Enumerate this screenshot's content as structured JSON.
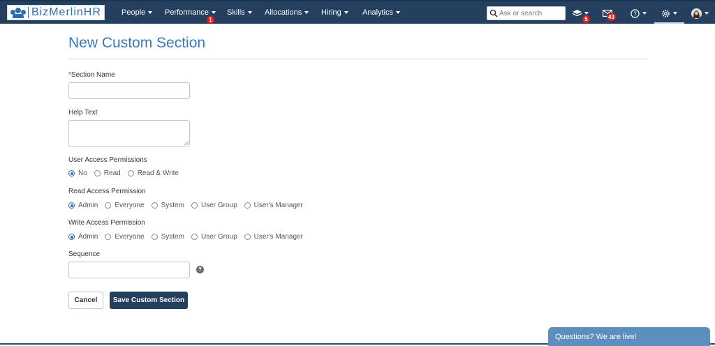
{
  "app": {
    "logo_text": "BizMerlinHR"
  },
  "nav": {
    "items": [
      {
        "label": "People"
      },
      {
        "label": "Performance",
        "badge": "1"
      },
      {
        "label": "Skills"
      },
      {
        "label": "Allocations"
      },
      {
        "label": "Hiring"
      },
      {
        "label": "Analytics"
      }
    ],
    "search_placeholder": "Ask or search",
    "icons": [
      {
        "name": "layers-icon",
        "badge": "5"
      },
      {
        "name": "mail-icon",
        "badge": "43"
      },
      {
        "name": "help-circle-icon"
      },
      {
        "name": "gear-icon"
      },
      {
        "name": "avatar"
      }
    ]
  },
  "page": {
    "title": "New Custom Section",
    "fields": {
      "section_name": {
        "label": "Section Name",
        "required_mark": "*",
        "value": ""
      },
      "help_text": {
        "label": "Help Text",
        "value": ""
      },
      "user_access": {
        "label": "User Access Permissions",
        "options": [
          "No",
          "Read",
          "Read & Write"
        ],
        "selected": "No"
      },
      "read_access": {
        "label": "Read Access Permission",
        "options": [
          "Admin",
          "Everyone",
          "System",
          "User Group",
          "User's Manager"
        ],
        "selected": "Admin"
      },
      "write_access": {
        "label": "Write Access Permission",
        "options": [
          "Admin",
          "Everyone",
          "System",
          "User Group",
          "User's Manager"
        ],
        "selected": "Admin"
      },
      "sequence": {
        "label": "Sequence",
        "value": "",
        "help_glyph": "?"
      }
    },
    "buttons": {
      "cancel": "Cancel",
      "save": "Save Custom Section"
    }
  },
  "chat": {
    "label": "Questions? We are live!"
  },
  "colors": {
    "navbar": "#253f5e",
    "accent": "#3a78b8",
    "badge": "#d9211b",
    "chat": "#5d8fbe"
  }
}
